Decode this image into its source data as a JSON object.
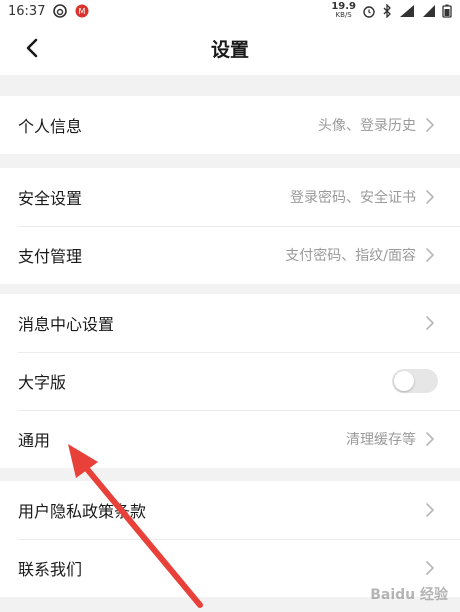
{
  "status_bar": {
    "time": "16:37",
    "net_speed": "19.9",
    "net_unit": "KB/S",
    "battery_icon": "battery-icon"
  },
  "nav": {
    "title": "设置",
    "back_icon": "chevron-left-icon"
  },
  "groups": [
    {
      "items": [
        {
          "label": "个人信息",
          "value": "头像、登录历史",
          "control": "chevron"
        }
      ]
    },
    {
      "items": [
        {
          "label": "安全设置",
          "value": "登录密码、安全证书",
          "control": "chevron"
        },
        {
          "label": "支付管理",
          "value": "支付密码、指纹/面容",
          "control": "chevron"
        }
      ]
    },
    {
      "items": [
        {
          "label": "消息中心设置",
          "value": "",
          "control": "chevron"
        },
        {
          "label": "大字版",
          "value": "",
          "control": "toggle",
          "toggle_on": false
        },
        {
          "label": "通用",
          "value": "清理缓存等",
          "control": "chevron"
        }
      ]
    },
    {
      "items": [
        {
          "label": "用户隐私政策条款",
          "value": "",
          "control": "chevron"
        },
        {
          "label": "联系我们",
          "value": "",
          "control": "chevron"
        }
      ]
    }
  ],
  "annotation": {
    "arrow_color": "#e8413a"
  },
  "colors": {
    "background": "#f2f2f2",
    "card": "#ffffff",
    "secondary_text": "#9a9a9a"
  }
}
